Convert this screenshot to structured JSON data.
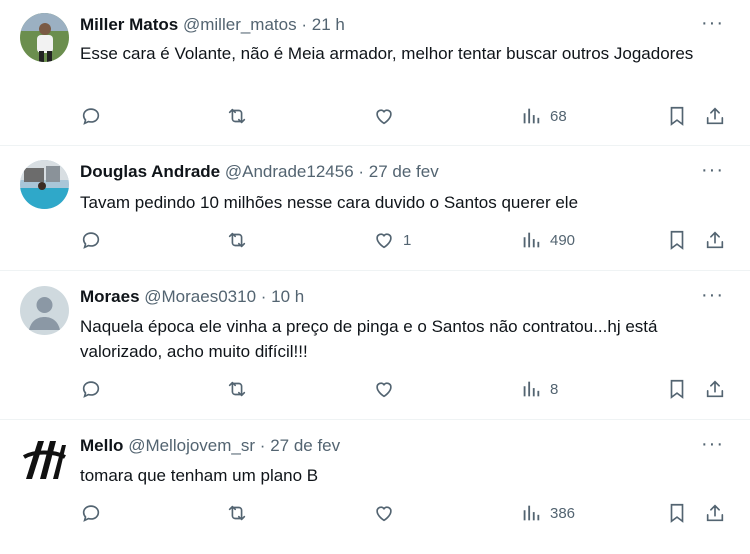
{
  "tweets": [
    {
      "name": "Miller Matos",
      "handle": "@miller_matos",
      "separator": "·",
      "time": "21 h",
      "text": "Esse cara é Volante, não é Meia armador, melhor tentar buscar outros Jogadores",
      "likes": "",
      "views": "68",
      "avatar": "photo-player-field"
    },
    {
      "name": "Douglas Andrade",
      "handle": "@Andrade12456",
      "separator": "·",
      "time": "27 de fev",
      "text": "Tavam pedindo 10 milhões nesse cara duvido o Santos querer ele",
      "likes": "1",
      "views": "490",
      "avatar": "photo-pool"
    },
    {
      "name": "Moraes",
      "handle": "@Moraes0310",
      "separator": "·",
      "time": "10 h",
      "text": "Naquela época ele vinha a preço de pinga e o Santos não contratou...hj está valorizado, acho muito difícil!!!",
      "likes": "",
      "views": "8",
      "avatar": "default-avatar"
    },
    {
      "name": "Mello",
      "handle": "@Mellojovem_sr",
      "separator": "·",
      "time": "27 de fev",
      "text": "tomara que tenham um plano B",
      "likes": "",
      "views": "386",
      "avatar": "logo-black-white"
    }
  ],
  "more_label": "···",
  "colors": {
    "text": "#0f1419",
    "secondary": "#536471",
    "border": "#eff3f4"
  }
}
